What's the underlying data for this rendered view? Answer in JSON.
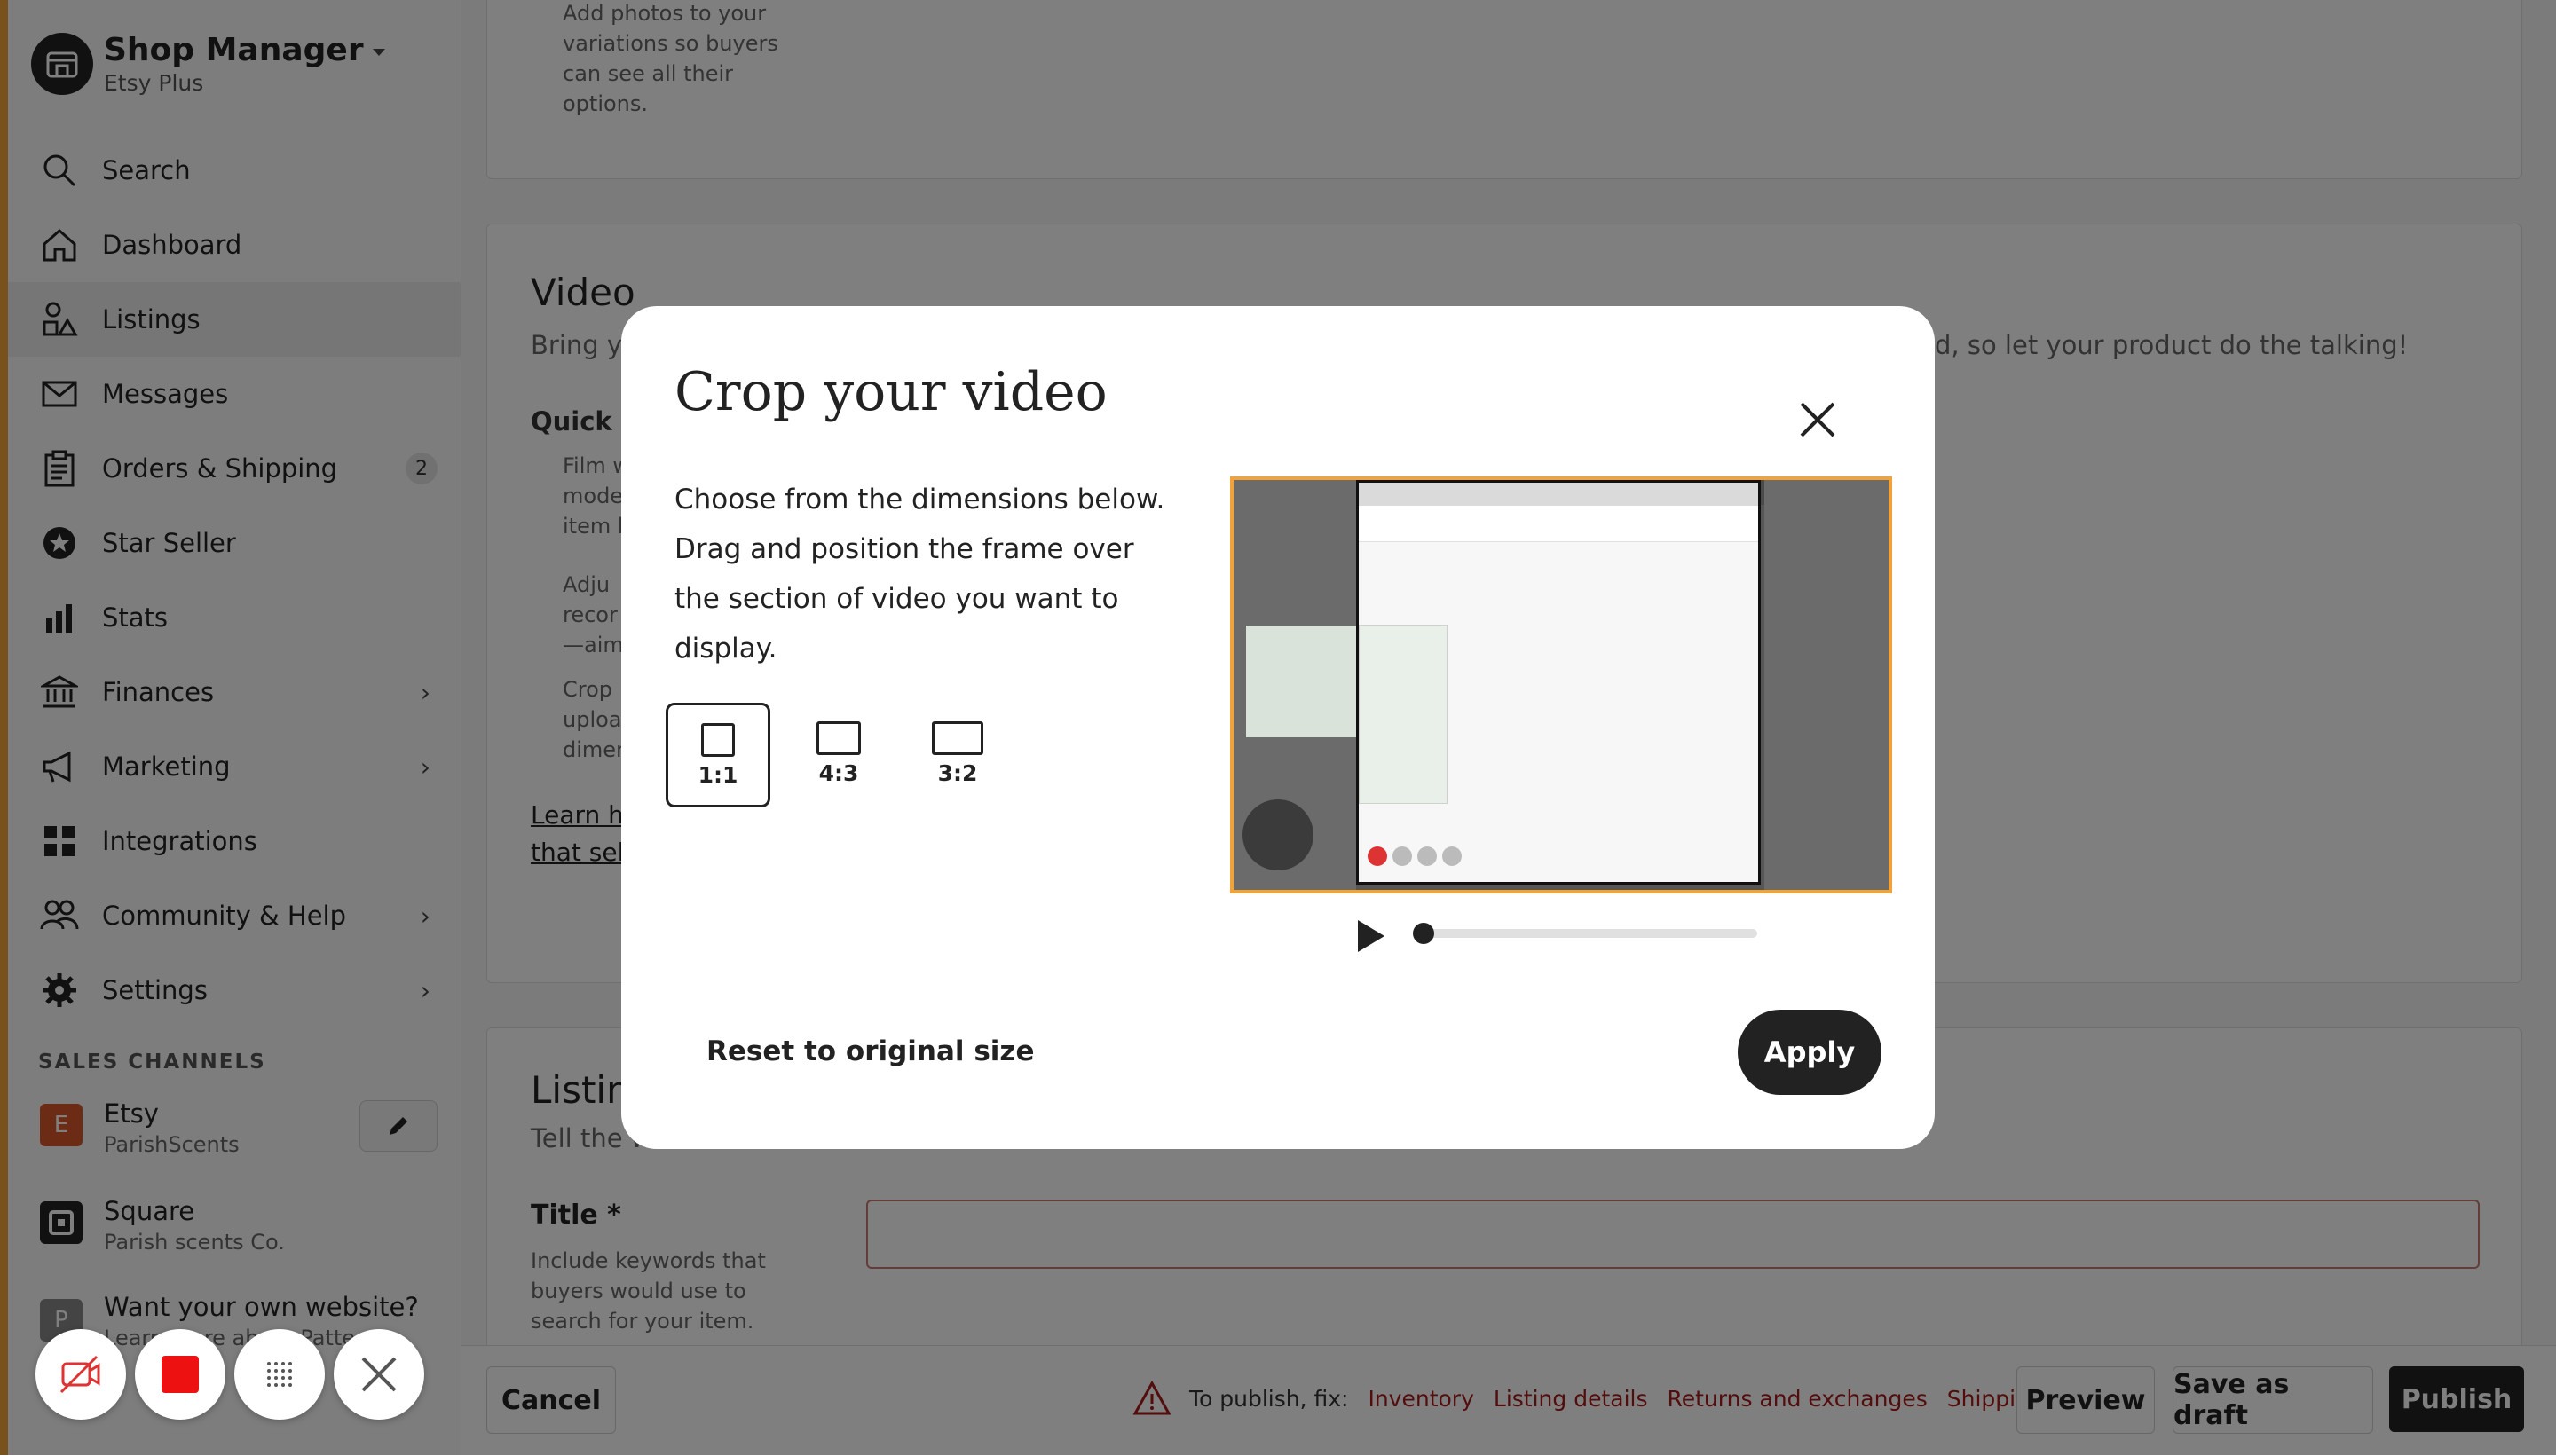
{
  "brand": {
    "title": "Shop Manager",
    "subtitle": "Etsy Plus"
  },
  "nav": [
    {
      "label": "Search",
      "icon": "search-icon"
    },
    {
      "label": "Dashboard",
      "icon": "home-icon"
    },
    {
      "label": "Listings",
      "icon": "shapes-icon",
      "active": true
    },
    {
      "label": "Messages",
      "icon": "mail-icon"
    },
    {
      "label": "Orders & Shipping",
      "icon": "clipboard-icon",
      "badge": "2"
    },
    {
      "label": "Star Seller",
      "icon": "star-badge-icon"
    },
    {
      "label": "Stats",
      "icon": "bar-chart-icon"
    },
    {
      "label": "Finances",
      "icon": "bank-icon",
      "chevron": true
    },
    {
      "label": "Marketing",
      "icon": "megaphone-icon",
      "chevron": true
    },
    {
      "label": "Integrations",
      "icon": "grid-icon"
    },
    {
      "label": "Community & Help",
      "icon": "people-icon",
      "chevron": true
    },
    {
      "label": "Settings",
      "icon": "gear-icon",
      "chevron": true
    }
  ],
  "sales_channels": {
    "heading": "SALES CHANNELS",
    "etsy": {
      "initial": "E",
      "name": "Etsy",
      "shop": "ParishScents"
    },
    "square": {
      "name": "Square",
      "shop": "Parish scents Co."
    },
    "website": {
      "initial": "P",
      "name": "Want your own website?",
      "sub": "Learn more about Pattern"
    }
  },
  "main": {
    "photos_tip": [
      "Add photos to your",
      "variations so buyers",
      "can see all their",
      "options."
    ],
    "video_heading": "Video",
    "video_sub_left": "Bring yo",
    "video_sub_right": "d, so let your product do the talking!",
    "quick_tips": "Quick ti",
    "tips": [
      "Film w",
      "mode",
      "item b",
      "Adju",
      "recor",
      "—aim",
      "Crop",
      "uploa",
      "dimer"
    ],
    "learn_line1": "Learn ho",
    "learn_line2": "that sell",
    "listing_heading": "Listin",
    "listing_sub": "Tell the w",
    "title_label": "Title *",
    "title_help": "Include keywords that buyers would use to search for your item."
  },
  "bottom": {
    "cancel": "Cancel",
    "fix_label": "To publish, fix:",
    "fix_links": [
      "Inventory",
      "Listing details",
      "Returns and exchanges",
      "Shipping"
    ],
    "preview": "Preview",
    "save_draft": "Save as draft",
    "publish": "Publish"
  },
  "modal": {
    "title": "Crop your video",
    "description": "Choose from the dimensions below. Drag and position the frame over the section of video you want to display.",
    "ratios": [
      "1:1",
      "4:3",
      "3:2"
    ],
    "selected_ratio": "1:1",
    "progress": 0,
    "reset": "Reset to original size",
    "apply": "Apply"
  },
  "recorder": [
    "camera-off-icon",
    "stop-icon",
    "dots-grid-icon",
    "close-icon"
  ],
  "colors": {
    "accent": "#f1a33b",
    "error": "#a61a1a",
    "dark": "#222222"
  }
}
